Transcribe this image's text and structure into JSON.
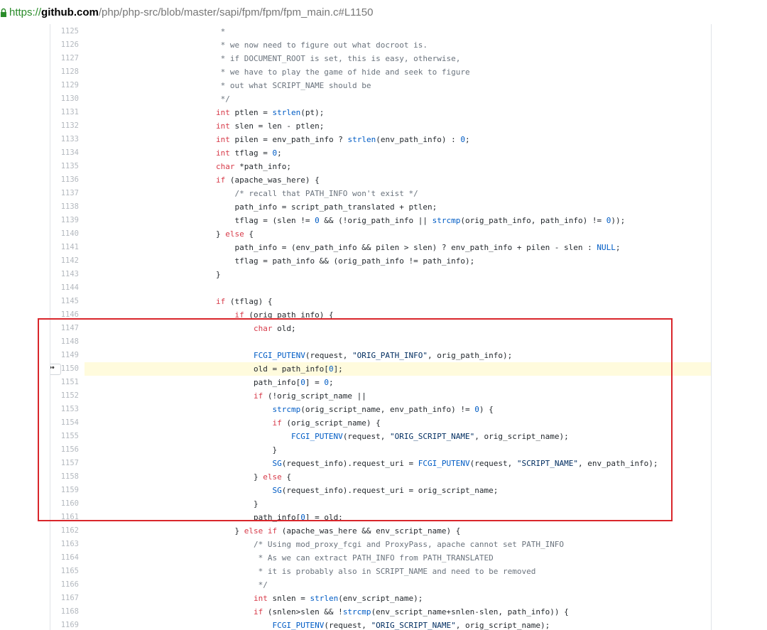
{
  "url": {
    "scheme": "https://",
    "host": "github.com",
    "path": "/php/php-src/blob/master/sapi/fpm/fpm/fpm_main.c#L1150"
  },
  "highlighted_line": 1150,
  "ellipsis_label": "•••",
  "colors": {
    "keyword": "#d73a49",
    "function": "#005cc5",
    "string": "#032f62",
    "comment": "#6a737d",
    "highlight_bg": "#fffbdd",
    "box_border": "#d9262b"
  },
  "lines": [
    {
      "n": "1125",
      "tokens": [
        [
          "c",
          "\t\t\t *"
        ]
      ]
    },
    {
      "n": "1126",
      "tokens": [
        [
          "c",
          "\t\t\t * we now need to figure out what docroot is."
        ]
      ]
    },
    {
      "n": "1127",
      "tokens": [
        [
          "c",
          "\t\t\t * if DOCUMENT_ROOT is set, this is easy, otherwise,"
        ]
      ]
    },
    {
      "n": "1128",
      "tokens": [
        [
          "c",
          "\t\t\t * we have to play the game of hide and seek to figure"
        ]
      ]
    },
    {
      "n": "1129",
      "tokens": [
        [
          "c",
          "\t\t\t * out what SCRIPT_NAME should be"
        ]
      ]
    },
    {
      "n": "1130",
      "tokens": [
        [
          "c",
          "\t\t\t */"
        ]
      ]
    },
    {
      "n": "1131",
      "tokens": [
        [
          "t",
          "\t\t\t"
        ],
        [
          "k",
          "int"
        ],
        [
          "t",
          " ptlen = "
        ],
        [
          "f",
          "strlen"
        ],
        [
          "t",
          "(pt);"
        ]
      ]
    },
    {
      "n": "1132",
      "tokens": [
        [
          "t",
          "\t\t\t"
        ],
        [
          "k",
          "int"
        ],
        [
          "t",
          " slen = len - ptlen;"
        ]
      ]
    },
    {
      "n": "1133",
      "tokens": [
        [
          "t",
          "\t\t\t"
        ],
        [
          "k",
          "int"
        ],
        [
          "t",
          " pilen = env_path_info ? "
        ],
        [
          "f",
          "strlen"
        ],
        [
          "t",
          "(env_path_info) : "
        ],
        [
          "n",
          "0"
        ],
        [
          "t",
          ";"
        ]
      ]
    },
    {
      "n": "1134",
      "tokens": [
        [
          "t",
          "\t\t\t"
        ],
        [
          "k",
          "int"
        ],
        [
          "t",
          " tflag = "
        ],
        [
          "n",
          "0"
        ],
        [
          "t",
          ";"
        ]
      ]
    },
    {
      "n": "1135",
      "tokens": [
        [
          "t",
          "\t\t\t"
        ],
        [
          "k",
          "char"
        ],
        [
          "t",
          " *path_info;"
        ]
      ]
    },
    {
      "n": "1136",
      "tokens": [
        [
          "t",
          "\t\t\t"
        ],
        [
          "k",
          "if"
        ],
        [
          "t",
          " (apache_was_here) {"
        ]
      ]
    },
    {
      "n": "1137",
      "tokens": [
        [
          "c",
          "\t\t\t\t/* recall that PATH_INFO won't exist */"
        ]
      ]
    },
    {
      "n": "1138",
      "tokens": [
        [
          "t",
          "\t\t\t\tpath_info = script_path_translated + ptlen;"
        ]
      ]
    },
    {
      "n": "1139",
      "tokens": [
        [
          "t",
          "\t\t\t\ttflag = (slen != "
        ],
        [
          "n",
          "0"
        ],
        [
          "t",
          " && (!orig_path_info || "
        ],
        [
          "f",
          "strcmp"
        ],
        [
          "t",
          "(orig_path_info, path_info) != "
        ],
        [
          "n",
          "0"
        ],
        [
          "t",
          "));"
        ]
      ]
    },
    {
      "n": "1140",
      "tokens": [
        [
          "t",
          "\t\t\t} "
        ],
        [
          "k",
          "else"
        ],
        [
          "t",
          " {"
        ]
      ]
    },
    {
      "n": "1141",
      "tokens": [
        [
          "t",
          "\t\t\t\tpath_info = (env_path_info && pilen > slen) ? env_path_info + pilen - slen : "
        ],
        [
          "n",
          "NULL"
        ],
        [
          "t",
          ";"
        ]
      ]
    },
    {
      "n": "1142",
      "tokens": [
        [
          "t",
          "\t\t\t\ttflag = path_info && (orig_path_info != path_info);"
        ]
      ]
    },
    {
      "n": "1143",
      "tokens": [
        [
          "t",
          "\t\t\t}"
        ]
      ]
    },
    {
      "n": "1144",
      "tokens": [
        [
          "t",
          ""
        ]
      ]
    },
    {
      "n": "1145",
      "tokens": [
        [
          "t",
          "\t\t\t"
        ],
        [
          "k",
          "if"
        ],
        [
          "t",
          " (tflag) {"
        ]
      ]
    },
    {
      "n": "1146",
      "tokens": [
        [
          "t",
          "\t\t\t\t"
        ],
        [
          "k",
          "if"
        ],
        [
          "t",
          " (orig_path_info) {"
        ]
      ]
    },
    {
      "n": "1147",
      "tokens": [
        [
          "t",
          "\t\t\t\t\t"
        ],
        [
          "k",
          "char"
        ],
        [
          "t",
          " old;"
        ]
      ]
    },
    {
      "n": "1148",
      "tokens": [
        [
          "t",
          ""
        ]
      ]
    },
    {
      "n": "1149",
      "tokens": [
        [
          "t",
          "\t\t\t\t\t"
        ],
        [
          "f",
          "FCGI_PUTENV"
        ],
        [
          "t",
          "(request, "
        ],
        [
          "s",
          "\"ORIG_PATH_INFO\""
        ],
        [
          "t",
          ", orig_path_info);"
        ]
      ]
    },
    {
      "n": "1150",
      "tokens": [
        [
          "t",
          "\t\t\t\t\told = path_info["
        ],
        [
          "n",
          "0"
        ],
        [
          "t",
          "];"
        ]
      ]
    },
    {
      "n": "1151",
      "tokens": [
        [
          "t",
          "\t\t\t\t\tpath_info["
        ],
        [
          "n",
          "0"
        ],
        [
          "t",
          "] = "
        ],
        [
          "n",
          "0"
        ],
        [
          "t",
          ";"
        ]
      ]
    },
    {
      "n": "1152",
      "tokens": [
        [
          "t",
          "\t\t\t\t\t"
        ],
        [
          "k",
          "if"
        ],
        [
          "t",
          " (!orig_script_name ||"
        ]
      ]
    },
    {
      "n": "1153",
      "tokens": [
        [
          "t",
          "\t\t\t\t\t\t"
        ],
        [
          "f",
          "strcmp"
        ],
        [
          "t",
          "(orig_script_name, env_path_info) != "
        ],
        [
          "n",
          "0"
        ],
        [
          "t",
          ") {"
        ]
      ]
    },
    {
      "n": "1154",
      "tokens": [
        [
          "t",
          "\t\t\t\t\t\t"
        ],
        [
          "k",
          "if"
        ],
        [
          "t",
          " (orig_script_name) {"
        ]
      ]
    },
    {
      "n": "1155",
      "tokens": [
        [
          "t",
          "\t\t\t\t\t\t\t"
        ],
        [
          "f",
          "FCGI_PUTENV"
        ],
        [
          "t",
          "(request, "
        ],
        [
          "s",
          "\"ORIG_SCRIPT_NAME\""
        ],
        [
          "t",
          ", orig_script_name);"
        ]
      ]
    },
    {
      "n": "1156",
      "tokens": [
        [
          "t",
          "\t\t\t\t\t\t}"
        ]
      ]
    },
    {
      "n": "1157",
      "tokens": [
        [
          "t",
          "\t\t\t\t\t\t"
        ],
        [
          "f",
          "SG"
        ],
        [
          "t",
          "(request_info).request_uri = "
        ],
        [
          "f",
          "FCGI_PUTENV"
        ],
        [
          "t",
          "(request, "
        ],
        [
          "s",
          "\"SCRIPT_NAME\""
        ],
        [
          "t",
          ", env_path_info);"
        ]
      ]
    },
    {
      "n": "1158",
      "tokens": [
        [
          "t",
          "\t\t\t\t\t} "
        ],
        [
          "k",
          "else"
        ],
        [
          "t",
          " {"
        ]
      ]
    },
    {
      "n": "1159",
      "tokens": [
        [
          "t",
          "\t\t\t\t\t\t"
        ],
        [
          "f",
          "SG"
        ],
        [
          "t",
          "(request_info).request_uri = orig_script_name;"
        ]
      ]
    },
    {
      "n": "1160",
      "tokens": [
        [
          "t",
          "\t\t\t\t\t}"
        ]
      ]
    },
    {
      "n": "1161",
      "tokens": [
        [
          "t",
          "\t\t\t\t\tpath_info["
        ],
        [
          "n",
          "0"
        ],
        [
          "t",
          "] = old;"
        ]
      ]
    },
    {
      "n": "1162",
      "tokens": [
        [
          "t",
          "\t\t\t\t} "
        ],
        [
          "k",
          "else if"
        ],
        [
          "t",
          " (apache_was_here && env_script_name) {"
        ]
      ]
    },
    {
      "n": "1163",
      "tokens": [
        [
          "c",
          "\t\t\t\t\t/* Using mod_proxy_fcgi and ProxyPass, apache cannot set PATH_INFO"
        ]
      ]
    },
    {
      "n": "1164",
      "tokens": [
        [
          "c",
          "\t\t\t\t\t * As we can extract PATH_INFO from PATH_TRANSLATED"
        ]
      ]
    },
    {
      "n": "1165",
      "tokens": [
        [
          "c",
          "\t\t\t\t\t * it is probably also in SCRIPT_NAME and need to be removed"
        ]
      ]
    },
    {
      "n": "1166",
      "tokens": [
        [
          "c",
          "\t\t\t\t\t */"
        ]
      ]
    },
    {
      "n": "1167",
      "tokens": [
        [
          "t",
          "\t\t\t\t\t"
        ],
        [
          "k",
          "int"
        ],
        [
          "t",
          " snlen = "
        ],
        [
          "f",
          "strlen"
        ],
        [
          "t",
          "(env_script_name);"
        ]
      ]
    },
    {
      "n": "1168",
      "tokens": [
        [
          "t",
          "\t\t\t\t\t"
        ],
        [
          "k",
          "if"
        ],
        [
          "t",
          " (snlen>slen && !"
        ],
        [
          "f",
          "strcmp"
        ],
        [
          "t",
          "(env_script_name+snlen-slen, path_info)) {"
        ]
      ]
    },
    {
      "n": "1169",
      "tokens": [
        [
          "t",
          "\t\t\t\t\t\t"
        ],
        [
          "f",
          "FCGI_PUTENV"
        ],
        [
          "t",
          "(request, "
        ],
        [
          "s",
          "\"ORIG_SCRIPT_NAME\""
        ],
        [
          "t",
          ", orig_script_name);"
        ]
      ]
    }
  ]
}
